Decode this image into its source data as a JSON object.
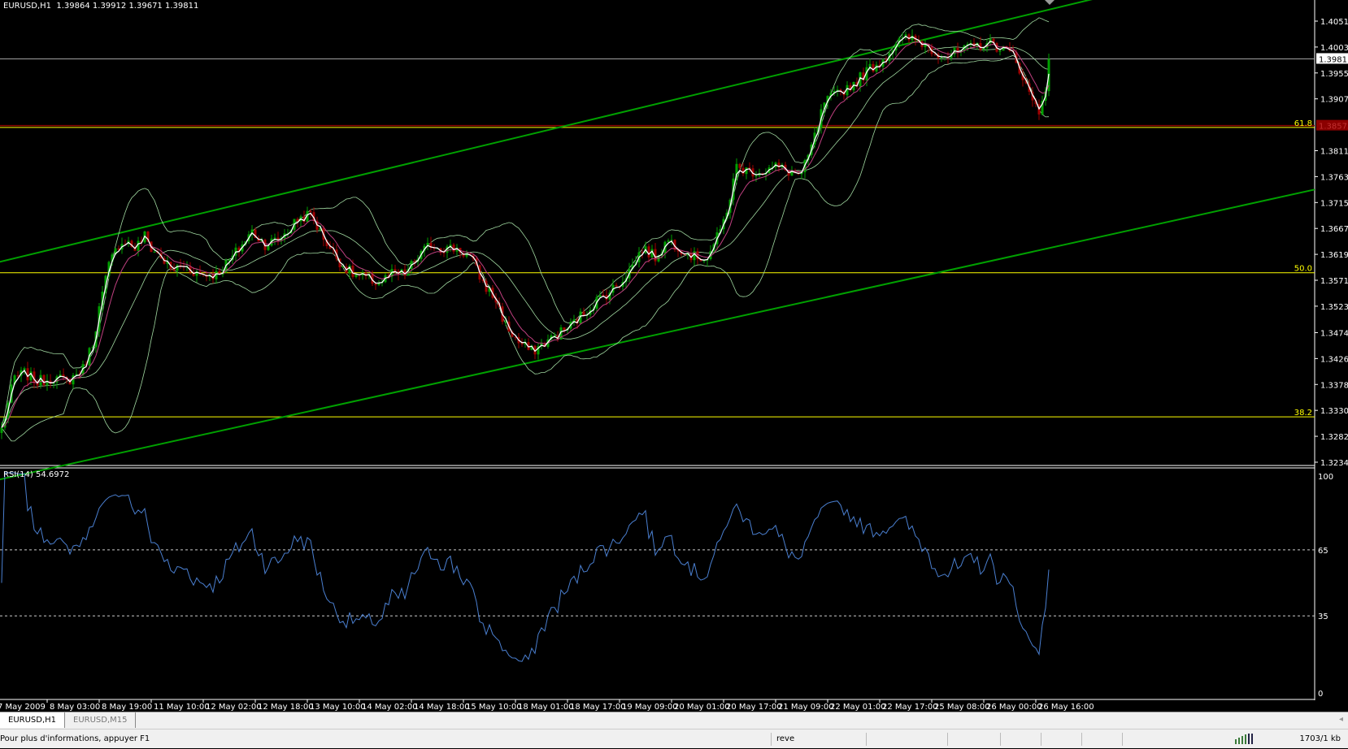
{
  "header": {
    "symbol": "EURUSD,H1",
    "quote": "1.39864 1.39912 1.39671 1.39811"
  },
  "price_axis": {
    "labels": [
      "1.40510",
      "1.40030",
      "1.39550",
      "1.39070",
      "1.38110",
      "1.37630",
      "1.37150",
      "1.36670",
      "1.36190",
      "1.35710",
      "1.35230",
      "1.34740",
      "1.34260",
      "1.33780",
      "1.33300",
      "1.32820",
      "1.32340"
    ],
    "current_price": "1.39811",
    "alert_price": "1.38575"
  },
  "fib_levels": [
    {
      "label": "61.8",
      "price": 1.3854
    },
    {
      "label": "50.0",
      "price": 1.3585
    },
    {
      "label": "38.2",
      "price": 1.3318
    }
  ],
  "trendlines": [
    {
      "name": "upper-channel",
      "from": [
        0,
        1.3606
      ],
      "to": [
        335,
        1.4091
      ],
      "color": "#00a000"
    },
    {
      "name": "lower-channel",
      "from": [
        22,
        1.3232
      ],
      "to": [
        415,
        1.3754
      ],
      "color": "#00a000"
    }
  ],
  "rsi": {
    "label": "RSI(14) 54.6972",
    "levels": [
      "100",
      "65",
      "35",
      "0"
    ]
  },
  "time_axis": [
    "7 May 2009",
    "8 May 03:00",
    "8 May 19:00",
    "11 May 10:00",
    "12 May 02:00",
    "12 May 18:00",
    "13 May 10:00",
    "14 May 02:00",
    "14 May 18:00",
    "15 May 10:00",
    "18 May 01:00",
    "18 May 17:00",
    "19 May 09:00",
    "20 May 01:00",
    "20 May 17:00",
    "21 May 09:00",
    "22 May 01:00",
    "22 May 17:00",
    "25 May 08:00",
    "26 May 00:00",
    "26 May 16:00"
  ],
  "tabs": [
    {
      "label": "EURUSD,H1",
      "active": true
    },
    {
      "label": "EURUSD,M15",
      "active": false
    }
  ],
  "status": {
    "help": "Pour plus d'informations, appuyer F1",
    "profile": "reve",
    "traffic": "1703/1 kb"
  },
  "colors": {
    "bull": "#00a000",
    "bear": "#a00000",
    "fib": "#ffff00",
    "bands": "#a0d8a0",
    "ma": "#c04080",
    "rsi": "#4a7fd0",
    "alert": "#8b0000"
  },
  "chart_data": {
    "type": "line",
    "title": "EURUSD,H1",
    "x_unit": "hourly bar index",
    "ylim": [
      1.3234,
      1.408
    ],
    "close_keypoints": [
      [
        0,
        1.3296
      ],
      [
        4,
        1.3391
      ],
      [
        7,
        1.3399
      ],
      [
        11,
        1.3383
      ],
      [
        16,
        1.3391
      ],
      [
        20,
        1.3383
      ],
      [
        25,
        1.3407
      ],
      [
        28,
        1.3455
      ],
      [
        30,
        1.3518
      ],
      [
        33,
        1.3598
      ],
      [
        36,
        1.3638
      ],
      [
        38,
        1.3646
      ],
      [
        41,
        1.363
      ],
      [
        44,
        1.3653
      ],
      [
        46,
        1.363
      ],
      [
        49,
        1.3614
      ],
      [
        52,
        1.359
      ],
      [
        56,
        1.3598
      ],
      [
        61,
        1.3582
      ],
      [
        66,
        1.3582
      ],
      [
        70,
        1.3606
      ],
      [
        73,
        1.363
      ],
      [
        77,
        1.3661
      ],
      [
        81,
        1.3638
      ],
      [
        85,
        1.3646
      ],
      [
        89,
        1.3669
      ],
      [
        91,
        1.3685
      ],
      [
        95,
        1.3693
      ],
      [
        98,
        1.3661
      ],
      [
        101,
        1.363
      ],
      [
        105,
        1.3598
      ],
      [
        108,
        1.3582
      ],
      [
        112,
        1.3574
      ],
      [
        116,
        1.3566
      ],
      [
        120,
        1.3582
      ],
      [
        124,
        1.3582
      ],
      [
        128,
        1.3614
      ],
      [
        132,
        1.3638
      ],
      [
        136,
        1.363
      ],
      [
        140,
        1.363
      ],
      [
        144,
        1.3614
      ],
      [
        148,
        1.3566
      ],
      [
        152,
        1.3534
      ],
      [
        155,
        1.3487
      ],
      [
        159,
        1.3455
      ],
      [
        163,
        1.3439
      ],
      [
        167,
        1.3455
      ],
      [
        171,
        1.3471
      ],
      [
        175,
        1.3487
      ],
      [
        179,
        1.351
      ],
      [
        183,
        1.3534
      ],
      [
        187,
        1.355
      ],
      [
        190,
        1.3566
      ],
      [
        194,
        1.3598
      ],
      [
        197,
        1.363
      ],
      [
        201,
        1.3614
      ],
      [
        205,
        1.3646
      ],
      [
        209,
        1.363
      ],
      [
        213,
        1.3614
      ],
      [
        217,
        1.3614
      ],
      [
        221,
        1.3661
      ],
      [
        224,
        1.3725
      ],
      [
        226,
        1.3781
      ],
      [
        230,
        1.3773
      ],
      [
        234,
        1.3773
      ],
      [
        238,
        1.3781
      ],
      [
        242,
        1.3773
      ],
      [
        246,
        1.3765
      ],
      [
        250,
        1.3836
      ],
      [
        253,
        1.39
      ],
      [
        257,
        1.3916
      ],
      [
        261,
        1.3932
      ],
      [
        263,
        1.394
      ],
      [
        267,
        1.3964
      ],
      [
        271,
        1.3979
      ],
      [
        275,
        1.4011
      ],
      [
        279,
        1.4019
      ],
      [
        283,
        1.4011
      ],
      [
        287,
        1.3995
      ],
      [
        291,
        1.3987
      ],
      [
        295,
        1.3995
      ],
      [
        299,
        1.4003
      ],
      [
        303,
        1.4011
      ],
      [
        307,
        1.4003
      ],
      [
        311,
        1.3987
      ],
      [
        313,
        1.3964
      ],
      [
        316,
        1.3916
      ],
      [
        319,
        1.3884
      ],
      [
        321,
        1.3932
      ],
      [
        322,
        1.3981
      ]
    ]
  }
}
